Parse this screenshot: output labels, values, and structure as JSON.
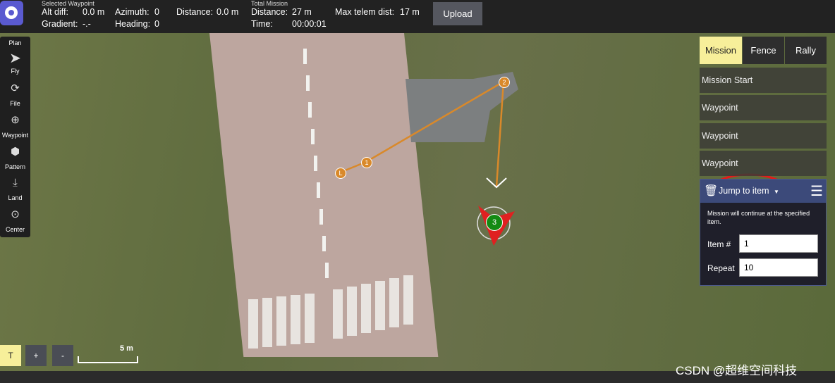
{
  "toolbar": {
    "selected_waypoint_title": "Selected Waypoint",
    "alt_diff_label": "Alt diff:",
    "alt_diff_value": "0.0 m",
    "gradient_label": "Gradient:",
    "gradient_value": "-.-",
    "azimuth_label": "Azimuth:",
    "azimuth_value": "0",
    "heading_label": "Heading:",
    "heading_value": "0",
    "distance_label": "Distance:",
    "distance_value": "0.0 m",
    "total_mission_title": "Total Mission",
    "total_distance_label": "Distance:",
    "total_distance_value": "27 m",
    "time_label": "Time:",
    "time_value": "00:00:01",
    "max_telem_label": "Max telem dist:",
    "max_telem_value": "17 m",
    "upload_label": "Upload"
  },
  "tools": [
    {
      "label": "Plan",
      "icon": "plan-icon"
    },
    {
      "label": "Fly",
      "icon": "fly-icon"
    },
    {
      "label": "File",
      "icon": "file-icon"
    },
    {
      "label": "Waypoint",
      "icon": "waypoint-icon"
    },
    {
      "label": "Pattern",
      "icon": "pattern-icon"
    },
    {
      "label": "Land",
      "icon": "land-icon"
    },
    {
      "label": "Center",
      "icon": "center-icon"
    }
  ],
  "map": {
    "markers": {
      "L": "L",
      "one": "1",
      "two": "2",
      "three": "3"
    },
    "scale_label": "5 m",
    "zoom_buttons": [
      "T",
      "+",
      "-"
    ],
    "route_color": "#d9892a",
    "vehicle_color": "#e02020",
    "current_item_color": "#138a13"
  },
  "right_panel": {
    "tabs": [
      "Mission",
      "Fence",
      "Rally"
    ],
    "active_tab": "Mission",
    "items": [
      "Mission Start",
      "Waypoint",
      "Waypoint",
      "Waypoint"
    ],
    "command": {
      "title": "Jump to item",
      "description": "Mission will continue at the specified item.",
      "item_label": "Item #",
      "item_value": "1",
      "repeat_label": "Repeat",
      "repeat_value": "10"
    }
  },
  "watermark": "CSDN @超维空间科技"
}
